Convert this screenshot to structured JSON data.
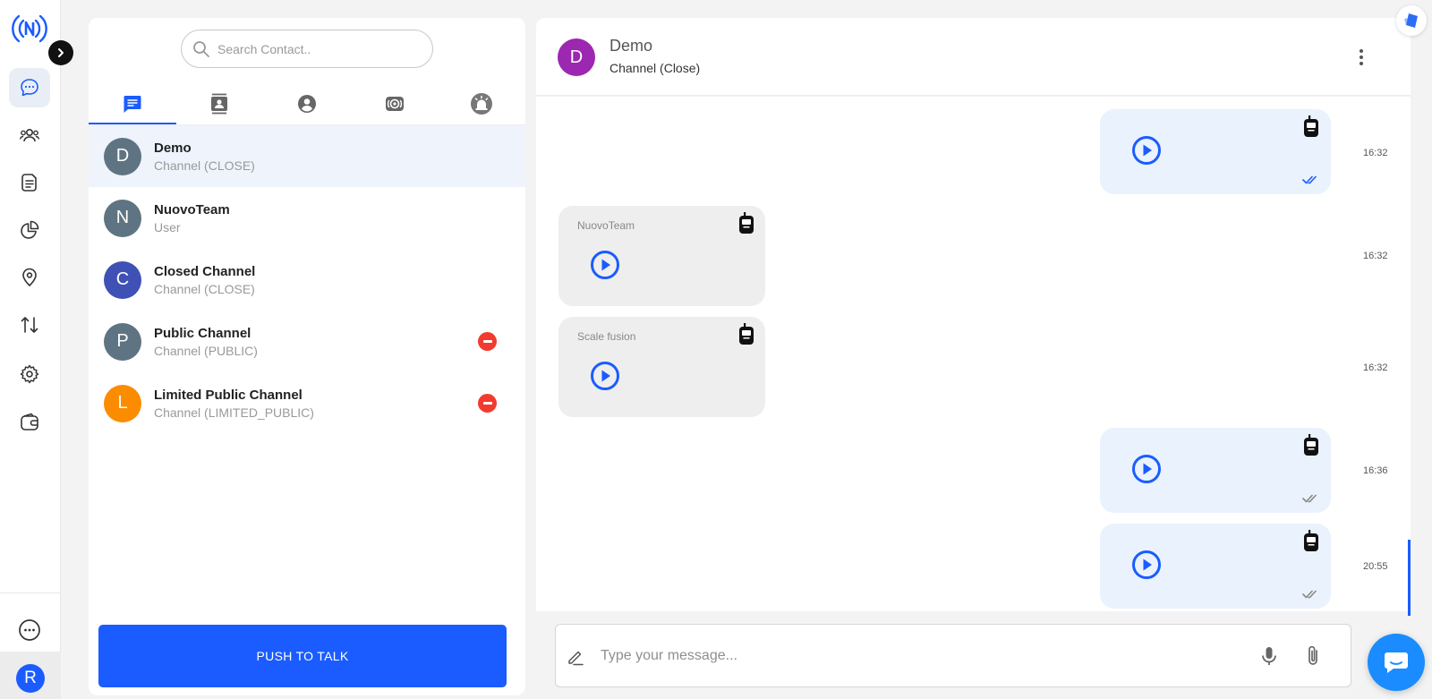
{
  "app": {
    "accent_color": "#1a5cff"
  },
  "nav": {
    "items": [
      {
        "name": "chat",
        "icon": "chat-bubble-icon",
        "active": true
      },
      {
        "name": "groups",
        "icon": "groups-icon"
      },
      {
        "name": "documents",
        "icon": "document-icon"
      },
      {
        "name": "reports",
        "icon": "pie-chart-icon"
      },
      {
        "name": "location",
        "icon": "location-pin-icon"
      },
      {
        "name": "transfer",
        "icon": "swap-arrows-icon"
      },
      {
        "name": "settings",
        "icon": "gear-icon"
      },
      {
        "name": "wallet",
        "icon": "wallet-icon"
      }
    ],
    "more_icon": "more-circle-icon",
    "user_initial": "R"
  },
  "contacts_panel": {
    "search_placeholder": "Search Contact..",
    "tabs": [
      {
        "icon": "chat-icon",
        "active": true
      },
      {
        "icon": "contacts-book-icon"
      },
      {
        "icon": "account-circle-icon"
      },
      {
        "icon": "broadcast-icon"
      },
      {
        "icon": "alarm-siren-icon"
      }
    ],
    "contacts": [
      {
        "initial": "D",
        "name": "Demo",
        "type": "Channel (CLOSE)",
        "color": "#5f7482",
        "selected": true,
        "removable": false
      },
      {
        "initial": "N",
        "name": "NuovoTeam",
        "type": "User",
        "color": "#5f7482",
        "selected": false,
        "removable": false
      },
      {
        "initial": "C",
        "name": "Closed Channel",
        "type": "Channel (CLOSE)",
        "color": "#3f51b5",
        "selected": false,
        "removable": false
      },
      {
        "initial": "P",
        "name": "Public Channel",
        "type": "Channel (PUBLIC)",
        "color": "#5f7482",
        "selected": false,
        "removable": true
      },
      {
        "initial": "L",
        "name": "Limited Public Channel",
        "type": "Channel (LIMITED_PUBLIC)",
        "color": "#fb8c00",
        "selected": false,
        "removable": true
      }
    ],
    "push_to_talk_label": "PUSH TO TALK"
  },
  "chat": {
    "header": {
      "initial": "D",
      "avatar_color": "#9c27b0",
      "name": "Demo",
      "subtitle": "Channel (Close)"
    },
    "messages": [
      {
        "direction": "out",
        "sender": "",
        "time": "16:32",
        "read": true
      },
      {
        "direction": "in",
        "sender": "NuovoTeam",
        "time": "16:32"
      },
      {
        "direction": "in",
        "sender": "Scale fusion",
        "time": "16:32"
      },
      {
        "direction": "out",
        "sender": "",
        "time": "16:36",
        "read": false
      },
      {
        "direction": "out",
        "sender": "",
        "time": "20:55",
        "read": false
      }
    ],
    "composer": {
      "placeholder": "Type your message..."
    }
  }
}
